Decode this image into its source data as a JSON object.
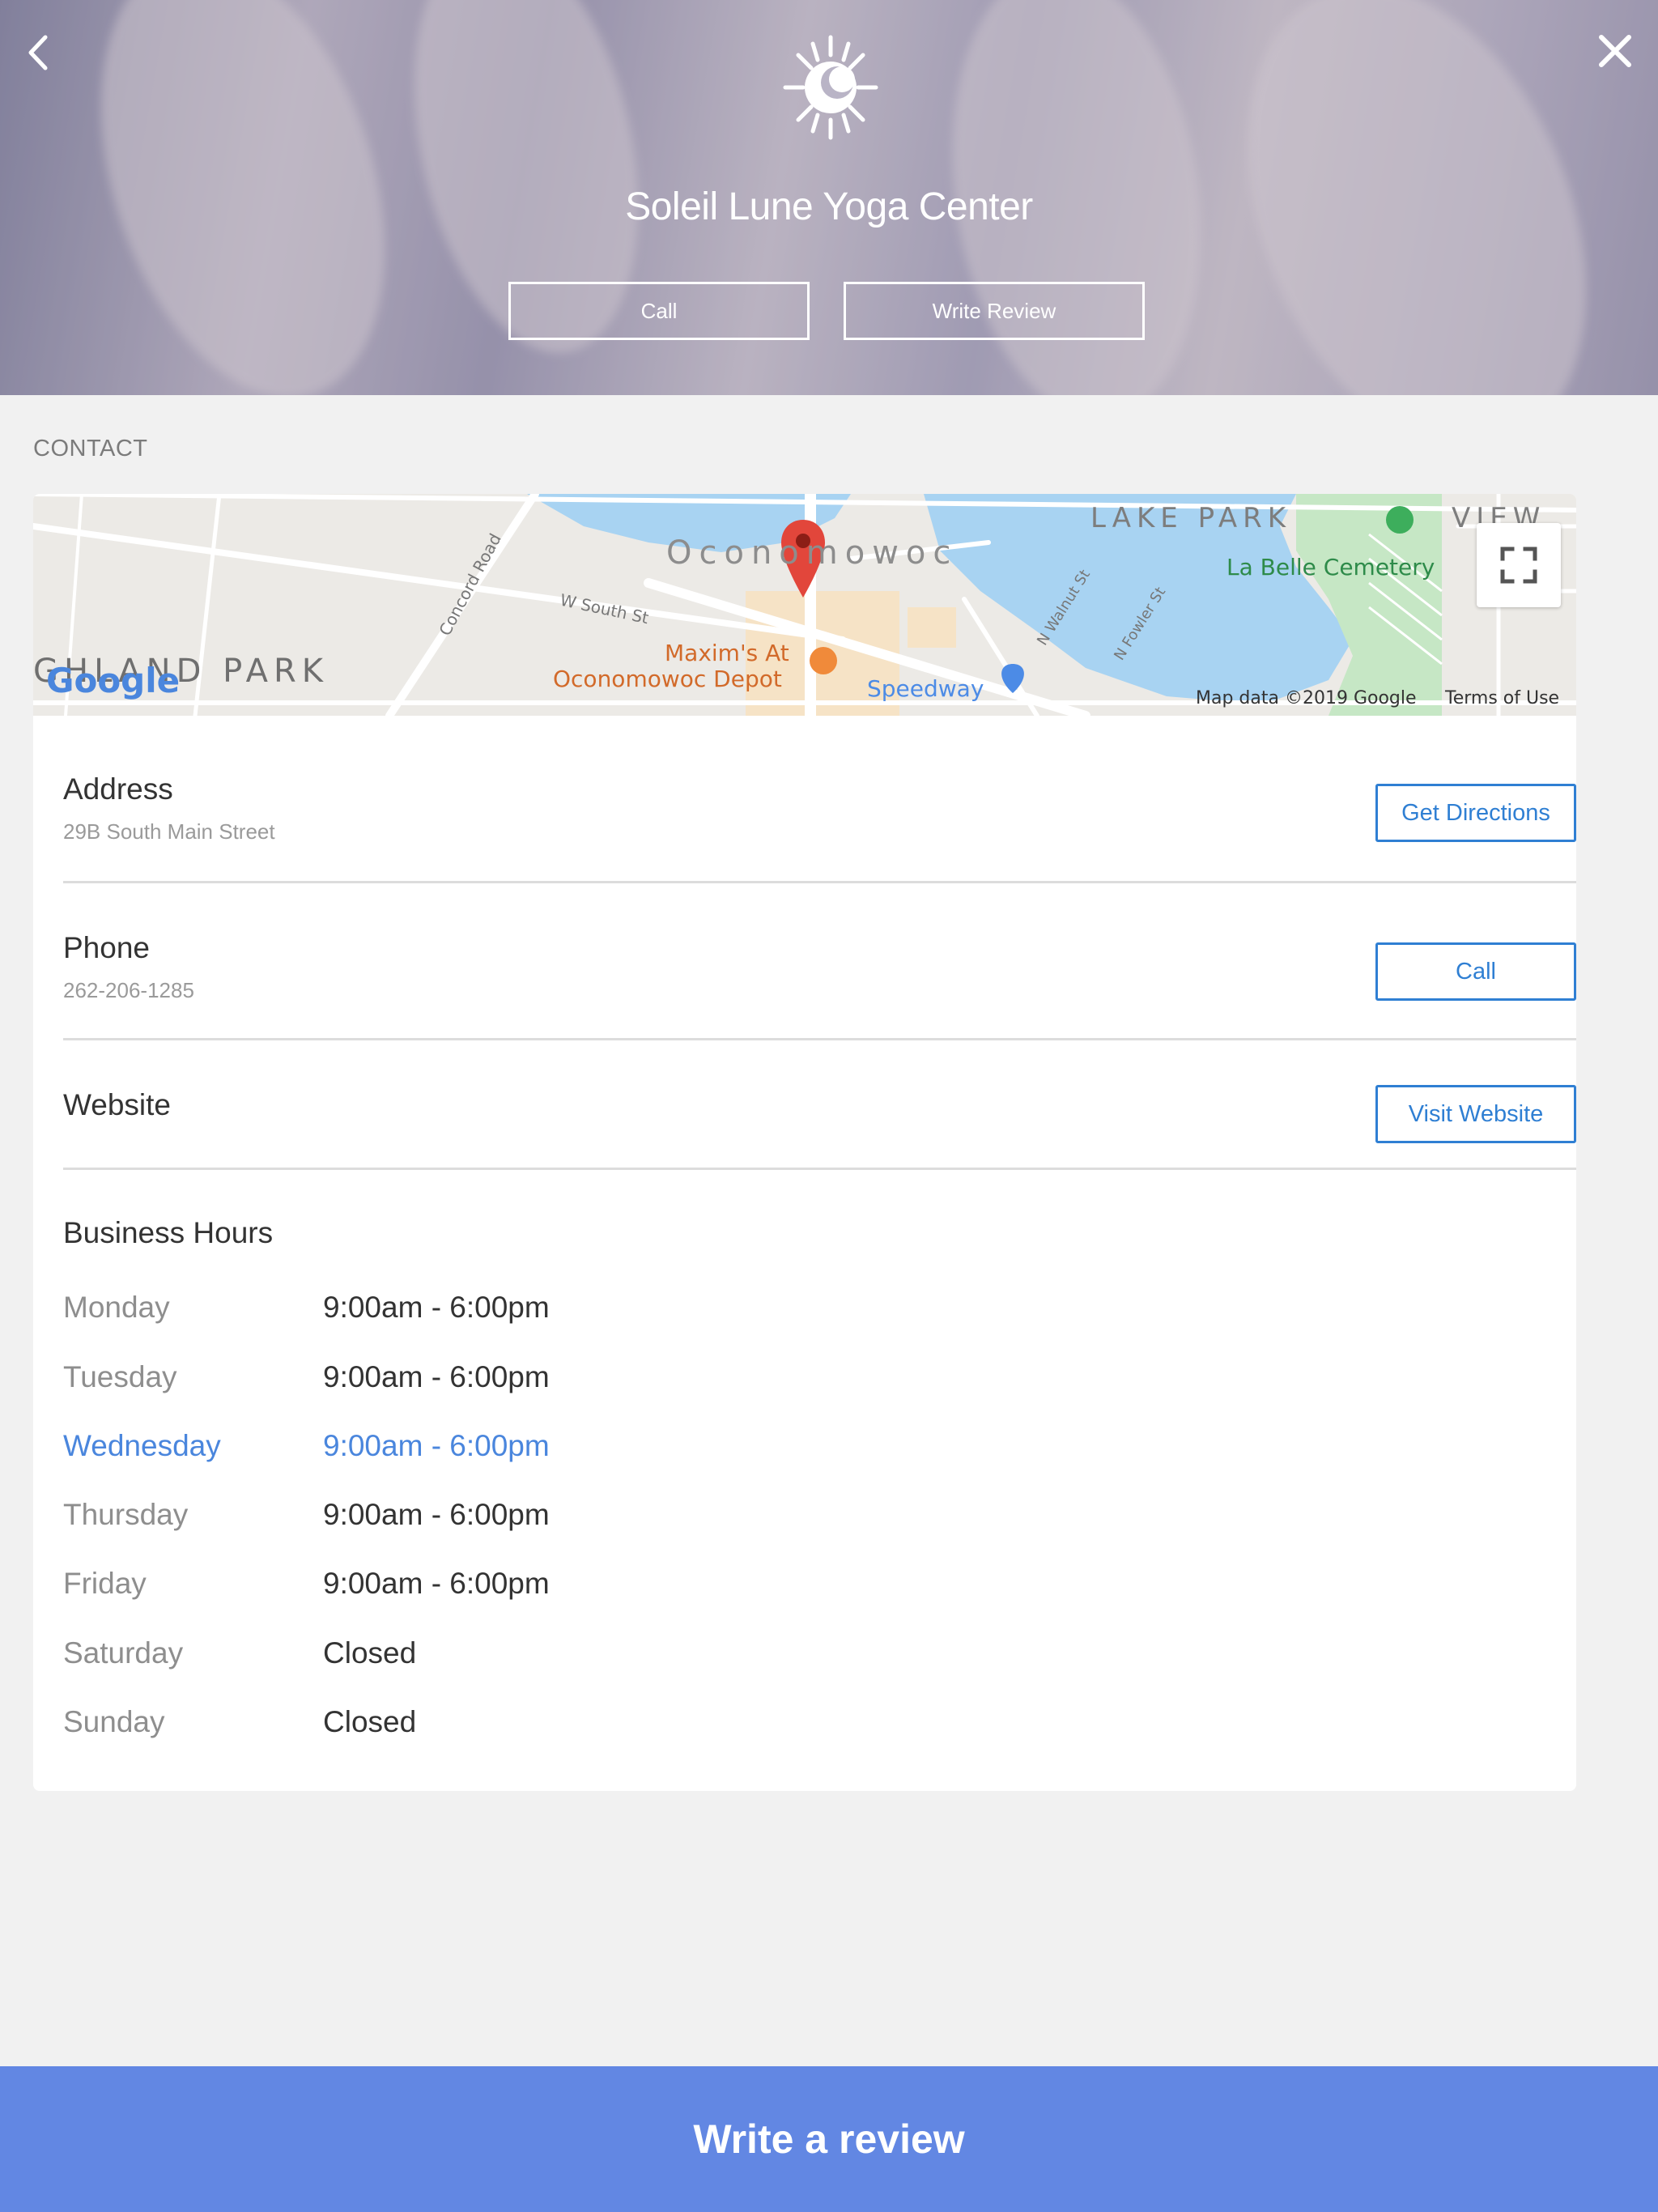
{
  "header": {
    "title": "Soleil Lune Yoga Center",
    "buttons": {
      "call": "Call",
      "write_review": "Write Review"
    },
    "icons": {
      "back": "chevron-left-icon",
      "close": "close-icon",
      "logo": "sun-moon-logo"
    }
  },
  "contact": {
    "section_label": "CONTACT",
    "map": {
      "labels": {
        "neighborhood_left": "GHLAND PARK",
        "town": "Oconomowoc",
        "lake_park": "LAKE PARK",
        "view": "VIEW",
        "cemetery": "La Belle Cemetery",
        "restaurant_line1": "Maxim's At",
        "restaurant_line2": "Oconomowoc Depot",
        "speedway": "Speedway",
        "concord_road": "Concord Road",
        "w_south_st": "W South St",
        "n_walnut_st": "N Walnut St",
        "n_fowler_st": "N Fowler St"
      },
      "brand": "Google",
      "attribution": "Map data ©2019 Google",
      "terms": "Terms of Use",
      "icons": {
        "pin": "map-pin-icon",
        "fullscreen": "fullscreen-icon"
      }
    },
    "address": {
      "label": "Address",
      "value": "29B South Main Street",
      "button": "Get Directions"
    },
    "phone": {
      "label": "Phone",
      "value": "262-206-1285",
      "button": "Call"
    },
    "website": {
      "label": "Website",
      "button": "Visit Website"
    },
    "hours": {
      "title": "Business Hours",
      "days": [
        {
          "day": "Monday",
          "time": "9:00am - 6:00pm"
        },
        {
          "day": "Tuesday",
          "time": "9:00am - 6:00pm"
        },
        {
          "day": "Wednesday",
          "time": "9:00am - 6:00pm"
        },
        {
          "day": "Thursday",
          "time": "9:00am - 6:00pm"
        },
        {
          "day": "Friday",
          "time": "9:00am - 6:00pm"
        },
        {
          "day": "Saturday",
          "time": "Closed"
        },
        {
          "day": "Sunday",
          "time": "Closed"
        }
      ],
      "highlighted_day": "Wednesday"
    }
  },
  "footer": {
    "cta": "Write a review"
  },
  "colors": {
    "accent": "#2f7fd3",
    "cta_background": "#6287e3",
    "today_highlight": "#4a86dd"
  }
}
